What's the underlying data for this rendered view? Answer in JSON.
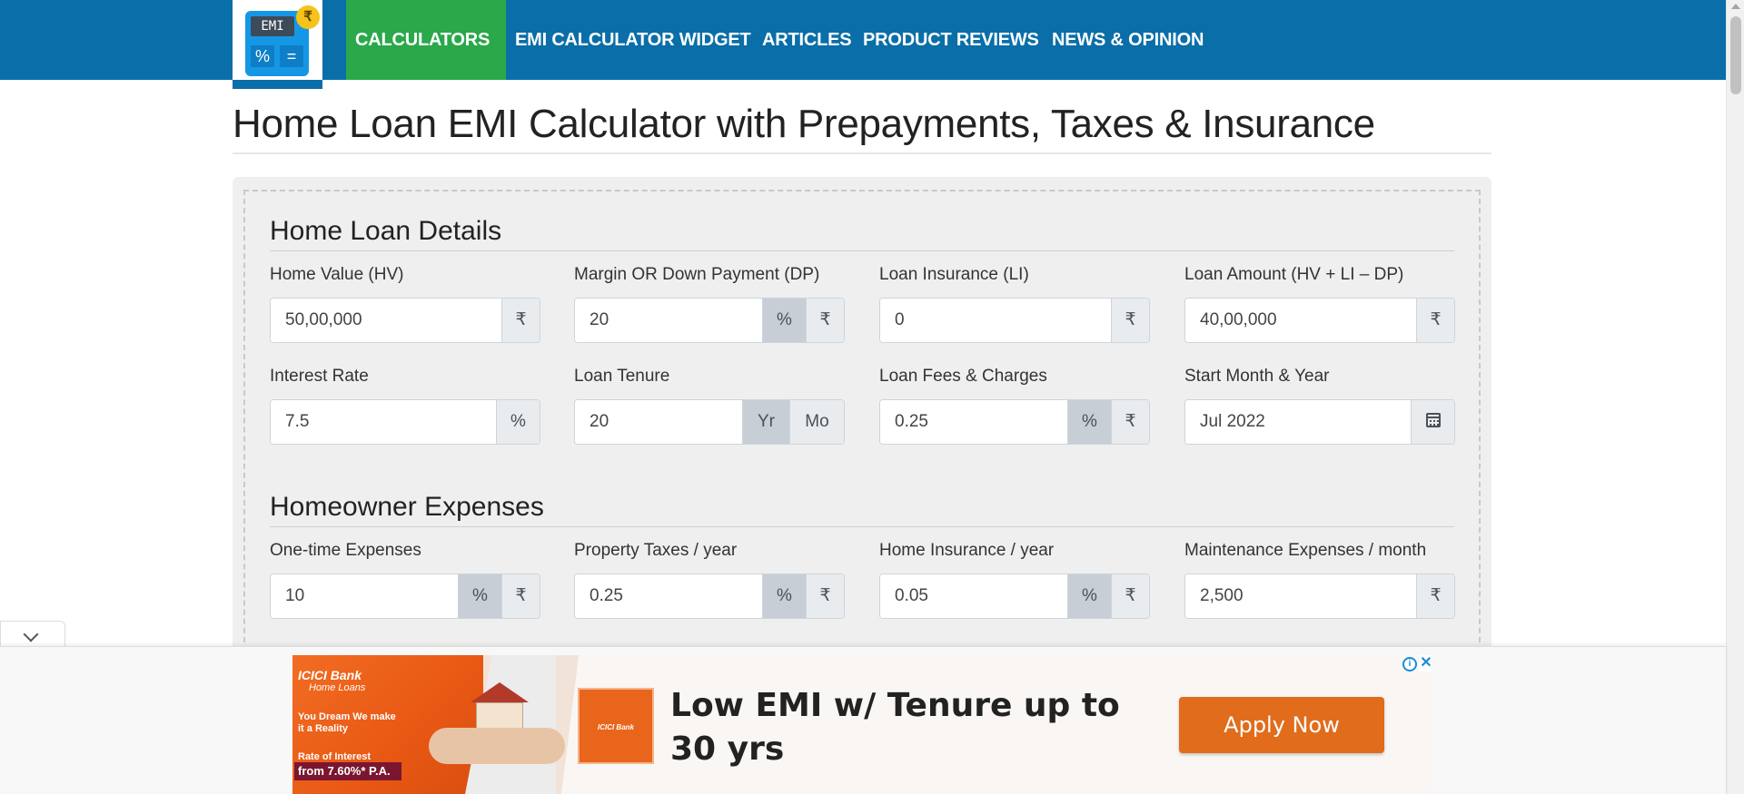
{
  "logo": {
    "screen_text": "EMI",
    "pct_key": "%",
    "eq_key": "=",
    "coin": "₹"
  },
  "nav": {
    "calculators": "CALCULATORS",
    "widget": "EMI CALCULATOR WIDGET",
    "articles": "ARTICLES",
    "reviews": "PRODUCT REVIEWS",
    "news": "NEWS & OPINION"
  },
  "page_title": "Home Loan EMI Calculator with Prepayments, Taxes & Insurance",
  "loan_details": {
    "title": "Home Loan Details",
    "home_value": {
      "label": "Home Value (HV)",
      "value": "50,00,000",
      "unit": "₹"
    },
    "down_payment": {
      "label": "Margin OR Down Payment (DP)",
      "value": "20",
      "unit_pct": "%",
      "unit_rs": "₹"
    },
    "loan_insurance": {
      "label": "Loan Insurance (LI)",
      "value": "0",
      "unit": "₹"
    },
    "loan_amount": {
      "label": "Loan Amount (HV + LI – DP)",
      "value": "40,00,000",
      "unit": "₹"
    },
    "interest_rate": {
      "label": "Interest Rate",
      "value": "7.5",
      "unit": "%"
    },
    "loan_tenure": {
      "label": "Loan Tenure",
      "value": "20",
      "unit_yr": "Yr",
      "unit_mo": "Mo"
    },
    "loan_fees": {
      "label": "Loan Fees & Charges",
      "value": "0.25",
      "unit_pct": "%",
      "unit_rs": "₹"
    },
    "start_month": {
      "label": "Start Month & Year",
      "value": "Jul 2022"
    }
  },
  "homeowner_expenses": {
    "title": "Homeowner Expenses",
    "one_time": {
      "label": "One-time Expenses",
      "value": "10",
      "unit_pct": "%",
      "unit_rs": "₹"
    },
    "property_taxes": {
      "label": "Property Taxes / year",
      "value": "0.25",
      "unit_pct": "%",
      "unit_rs": "₹"
    },
    "home_insurance": {
      "label": "Home Insurance / year",
      "value": "0.05",
      "unit_pct": "%",
      "unit_rs": "₹"
    },
    "maintenance": {
      "label": "Maintenance Expenses / month",
      "value": "2,500",
      "unit": "₹"
    }
  },
  "ad": {
    "bank": "ICICI Bank",
    "bank_sub": "Home Loans",
    "tagline": "You Dream We make it a Reality",
    "rate_label": "Rate of Interest",
    "rate_value": "from 7.60%* P.A.",
    "logo_text": "ICICI Bank",
    "headline": "Low EMI w/ Tenure up to 30 yrs",
    "cta": "Apply Now",
    "info": "i",
    "close": "✕"
  },
  "colors": {
    "nav_bg": "#0a6ea8",
    "nav_active": "#2aa84a",
    "panel_bg": "#efefef",
    "ad_cta": "#e06c1c"
  }
}
